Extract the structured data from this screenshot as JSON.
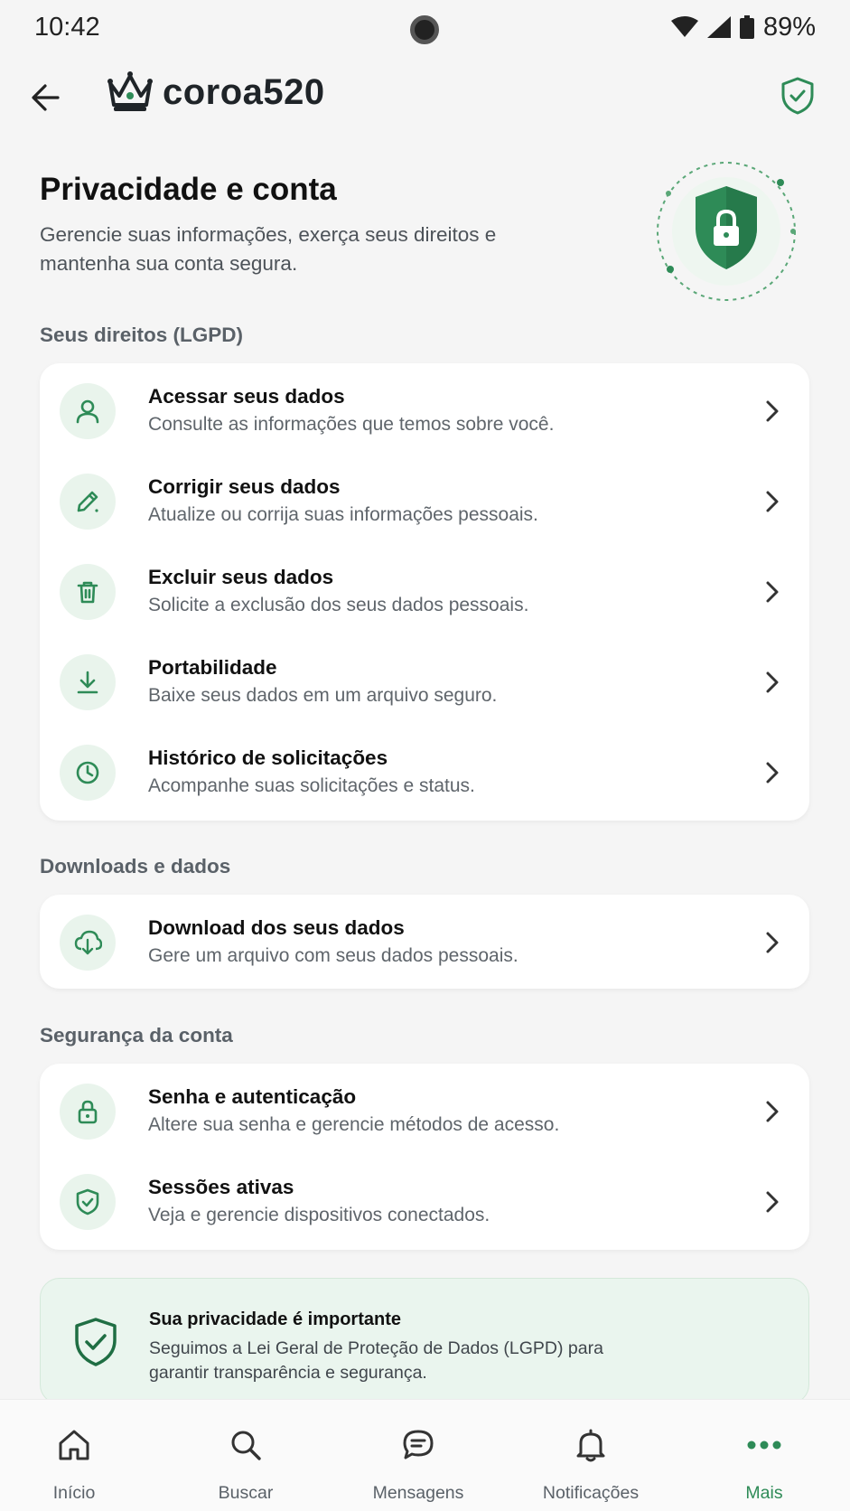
{
  "status": {
    "time": "10:42",
    "battery": "89%"
  },
  "header": {
    "logo_text": "coroa520"
  },
  "hero": {
    "title": "Privacidade e conta",
    "subtitle": "Gerencie suas informações, exerça seus direitos e mantenha sua conta segura."
  },
  "sections": {
    "rights": {
      "label": "Seus direitos (LGPD)",
      "items": [
        {
          "title": "Acessar seus dados",
          "desc": "Consulte as informações que temos sobre você.",
          "icon": "user-icon"
        },
        {
          "title": "Corrigir seus dados",
          "desc": "Atualize ou corrija suas informações pessoais.",
          "icon": "pencil-icon"
        },
        {
          "title": "Excluir seus dados",
          "desc": "Solicite a exclusão dos seus dados pessoais.",
          "icon": "trash-icon"
        },
        {
          "title": "Portabilidade",
          "desc": "Baixe seus dados em um arquivo seguro.",
          "icon": "download-icon"
        },
        {
          "title": "Histórico de solicitações",
          "desc": "Acompanhe suas solicitações e status.",
          "icon": "clock-icon"
        }
      ]
    },
    "downloads": {
      "label": "Downloads e dados",
      "items": [
        {
          "title": "Download dos seus dados",
          "desc": "Gere um arquivo com seus dados pessoais.",
          "icon": "cloud-download-icon"
        }
      ]
    },
    "security": {
      "label": "Segurança da conta",
      "items": [
        {
          "title": "Senha e autenticação",
          "desc": "Altere sua senha e gerencie métodos de acesso.",
          "icon": "lock-icon"
        },
        {
          "title": "Sessões ativas",
          "desc": "Veja e gerencie dispositivos conectados.",
          "icon": "shield-check-icon"
        }
      ]
    }
  },
  "info": {
    "title": "Sua privacidade é importante",
    "text": "Seguimos a Lei Geral de Proteção de Dados (LGPD) para garantir transparência e segurança."
  },
  "nav": {
    "items": [
      {
        "label": "Início",
        "icon": "home-icon"
      },
      {
        "label": "Buscar",
        "icon": "search-icon"
      },
      {
        "label": "Mensagens",
        "icon": "message-icon"
      },
      {
        "label": "Notificações",
        "icon": "bell-icon"
      },
      {
        "label": "Mais",
        "icon": "more-icon",
        "active": true
      }
    ]
  },
  "colors": {
    "accent": "#2e8b57",
    "icon_bg": "#e9f4ec",
    "info_bg": "#eaf5ee"
  }
}
